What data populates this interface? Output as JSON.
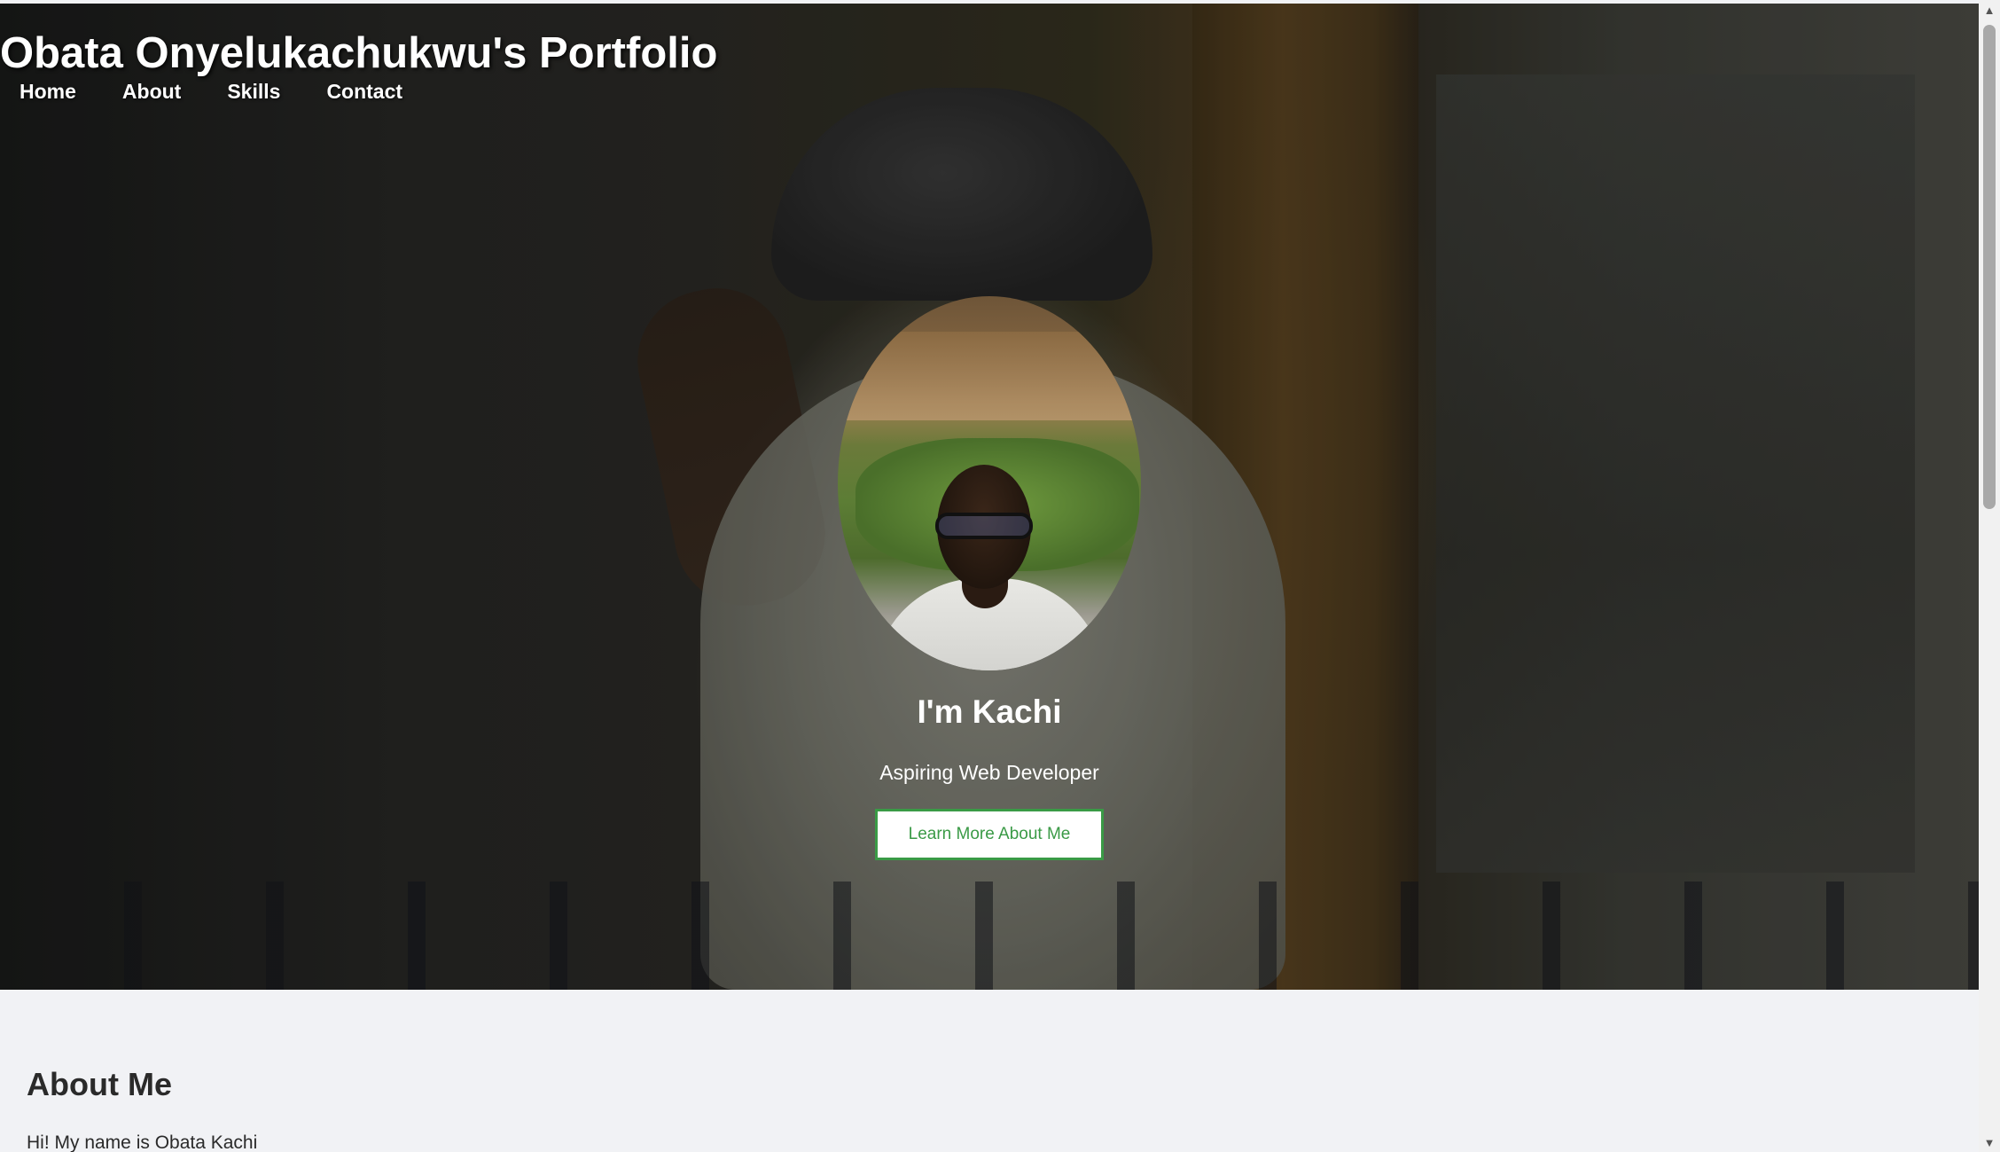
{
  "header": {
    "site_title": "Obata Onyelukachukwu's Portfolio",
    "nav": [
      {
        "label": "Home"
      },
      {
        "label": "About"
      },
      {
        "label": "Skills"
      },
      {
        "label": "Contact"
      }
    ]
  },
  "hero": {
    "greeting": "I'm Kachi",
    "tagline": "Aspiring Web Developer",
    "cta_label": "Learn More About Me",
    "accent_color": "#3a9a46"
  },
  "about": {
    "title": "About Me",
    "intro": "Hi! My name is Obata Kachi"
  },
  "scrollbar": {
    "up_icon": "▲",
    "down_icon": "▼"
  }
}
